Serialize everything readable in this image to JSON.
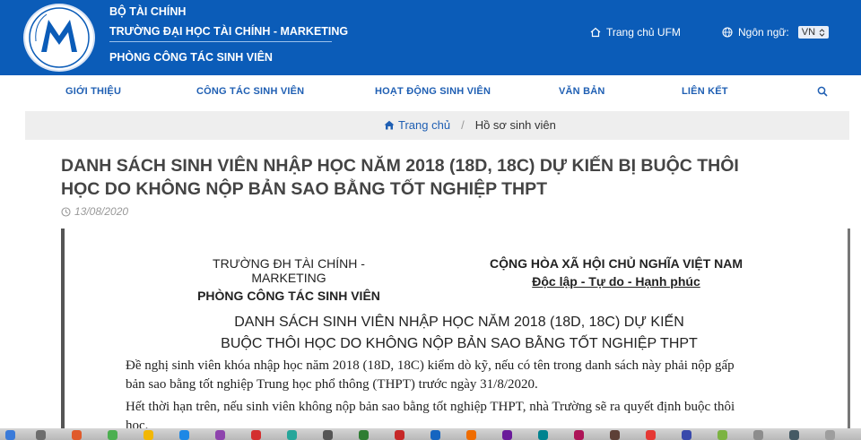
{
  "header": {
    "org_line1": "BỘ TÀI CHÍNH",
    "org_line2": "TRƯỜNG ĐẠI HỌC TÀI CHÍNH - MARKETING",
    "org_line3": "PHÒNG CÔNG TÁC SINH VIÊN",
    "home_link": "Trang chủ UFM",
    "lang_label": "Ngôn ngữ:",
    "lang_value": "VN",
    "logo_text_top": "UNIVERSITY OF FINANCE",
    "logo_text_bottom": "TRƯỜNG ĐH TÀI CHÍNH - MARKETING"
  },
  "nav": {
    "items": [
      "GIỚI THIỆU",
      "CÔNG TÁC SINH VIÊN",
      "HOẠT ĐỘNG SINH VIÊN",
      "VĂN BẢN",
      "LIÊN KẾT"
    ]
  },
  "breadcrumb": {
    "home": "Trang chủ",
    "current": "Hồ sơ sinh viên"
  },
  "article": {
    "title_line1": "DANH SÁCH SINH VIÊN NHẬP HỌC NĂM 2018 (18D, 18C) DỰ KIẾN BỊ BUỘC THÔI",
    "title_line2": "HỌC DO KHÔNG NỘP BẢN SAO BẰNG TỐT NGHIỆP THPT",
    "date": "13/08/2020"
  },
  "doc": {
    "left_head1": "TRƯỜNG ĐH TÀI CHÍNH - MARKETING",
    "left_head2": "PHÒNG CÔNG TÁC SINH VIÊN",
    "right_head1": "CỘNG HÒA XÃ HỘI CHỦ NGHĨA VIỆT NAM",
    "right_head2": "Độc lập - Tự do - Hạnh phúc",
    "title1": "DANH SÁCH SINH VIÊN NHẬP HỌC NĂM 2018 (18D, 18C) DỰ KIẾN",
    "title2": "BUỘC THÔI HỌC DO KHÔNG NỘP BẢN SAO BẰNG TỐT NGHIỆP THPT",
    "para1_line1": "Đề nghị sinh viên khóa nhập học năm 2018 (18D, 18C) kiểm dò kỹ, nếu có tên trong danh sách này phải nộp gấp",
    "para1_line2": "bản sao bằng tốt nghiệp Trung học phổ thông (THPT) trước ngày 31/8/2020.",
    "para2_line1": "Hết thời hạn trên, nếu sinh viên không nộp bản sao bằng tốt nghiệp THPT, nhà Trường sẽ ra quyết định buộc thôi",
    "para2_line2": "học."
  },
  "colors": {
    "header_bg": "#0b5cb8",
    "nav_text": "#1f5fb3",
    "breadcrumb_bg": "#eeeeee",
    "title_text": "#444444"
  }
}
